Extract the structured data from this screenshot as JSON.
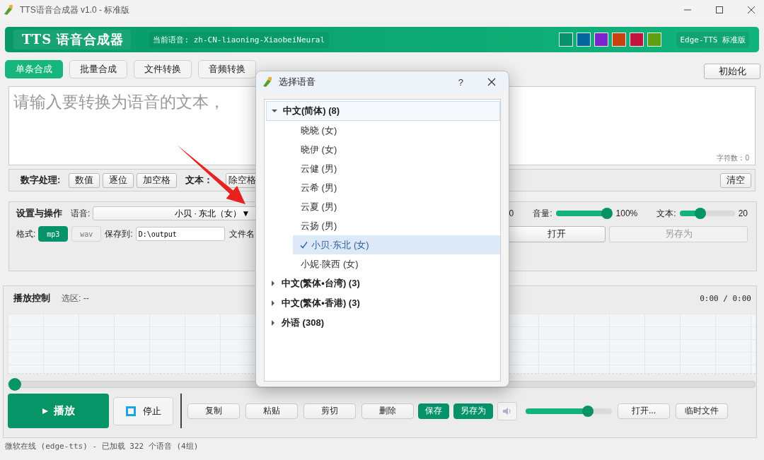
{
  "window": {
    "title": "TTS语音合成器 v1.0 - 标准版"
  },
  "header": {
    "title": "TTS 语音合成器",
    "voice_label": "当前语音:",
    "voice_value": "zh-CN-liaoning-XiaobeiNeural",
    "edition": "Edge-TTS 标准版",
    "themes": [
      {
        "color": "#07936a"
      },
      {
        "color": "#04679e"
      },
      {
        "color": "#7f22d1"
      },
      {
        "color": "#c8420f"
      },
      {
        "color": "#c5113e"
      },
      {
        "color": "#5f9f12"
      }
    ]
  },
  "tabs": [
    {
      "label": "单条合成",
      "selected": true
    },
    {
      "label": "批量合成",
      "selected": false
    },
    {
      "label": "文件转换",
      "selected": false
    },
    {
      "label": "音频转换",
      "selected": false
    }
  ],
  "reset_button": "初始化",
  "text_input": {
    "placeholder": "请输入要转换为语音的文本，",
    "char_count": "字符数：0"
  },
  "number_tools": {
    "label": "数字处理:",
    "buttons": [
      "数值",
      "逐位",
      "加空格"
    ]
  },
  "text_tools": {
    "label": "文本：",
    "buttons": [
      "除空格"
    ]
  },
  "clear_button": "清空",
  "settings": {
    "title": "设置与操作",
    "voice_label": "语音:",
    "voice_value": "小贝 · 东北（女）▼",
    "rate_reading": "0",
    "volume": {
      "label": "音量:",
      "level": 1,
      "reading": "100%"
    },
    "text_size": {
      "label": "文本:",
      "level": 0.34,
      "reading": "20"
    },
    "format_label": "格式:",
    "formats": [
      {
        "label": "mp3",
        "selected": true
      },
      {
        "label": "wav",
        "selected": false
      }
    ],
    "save_label": "保存到:",
    "save_path": "D:\\output",
    "filename_label": "文件名",
    "open_button": {
      "label": "打开",
      "disabled": false
    },
    "save_as_button": {
      "label": "另存为",
      "disabled": true
    }
  },
  "playback": {
    "title": "播放控制",
    "selection_label": "选区:",
    "selection_value": "--",
    "time": "0:00 / 0:00",
    "progress": {
      "level": 0
    },
    "play_button": "播放",
    "stop_button": "停止",
    "edit_buttons": [
      {
        "label": "复制",
        "kind": "plain"
      },
      {
        "label": "粘贴",
        "kind": "plain"
      },
      {
        "label": "剪切",
        "kind": "plain"
      },
      {
        "label": "删除",
        "kind": "plain"
      },
      {
        "label": "保存",
        "kind": "primary"
      },
      {
        "label": "另存为",
        "kind": "primary"
      }
    ],
    "volume": {
      "level": 0.75
    },
    "open_button": "打开...",
    "temp_button": "临时文件"
  },
  "status_bar": "微软在线 (edge-tts) - 已加载 322 个语音 (4组)",
  "dialog": {
    "title": "选择语音",
    "help": "?",
    "groups": [
      {
        "label": "中文(简体) (8)",
        "expanded": true,
        "selected": true,
        "children": [
          {
            "label": "晓晓 (女)",
            "selected": false
          },
          {
            "label": "晓伊 (女)",
            "selected": false
          },
          {
            "label": "云健 (男)",
            "selected": false
          },
          {
            "label": "云希 (男)",
            "selected": false
          },
          {
            "label": "云夏 (男)",
            "selected": false
          },
          {
            "label": "云扬 (男)",
            "selected": false
          },
          {
            "label": "小贝·东北 (女)",
            "selected": true
          },
          {
            "label": "小妮·陕西 (女)",
            "selected": false
          }
        ]
      },
      {
        "label": "中文(繁体•台湾) (3)",
        "expanded": false,
        "selected": false
      },
      {
        "label": "中文(繁体•香港) (3)",
        "expanded": false,
        "selected": false
      },
      {
        "label": "外语 (308)",
        "expanded": false,
        "selected": false
      }
    ]
  }
}
